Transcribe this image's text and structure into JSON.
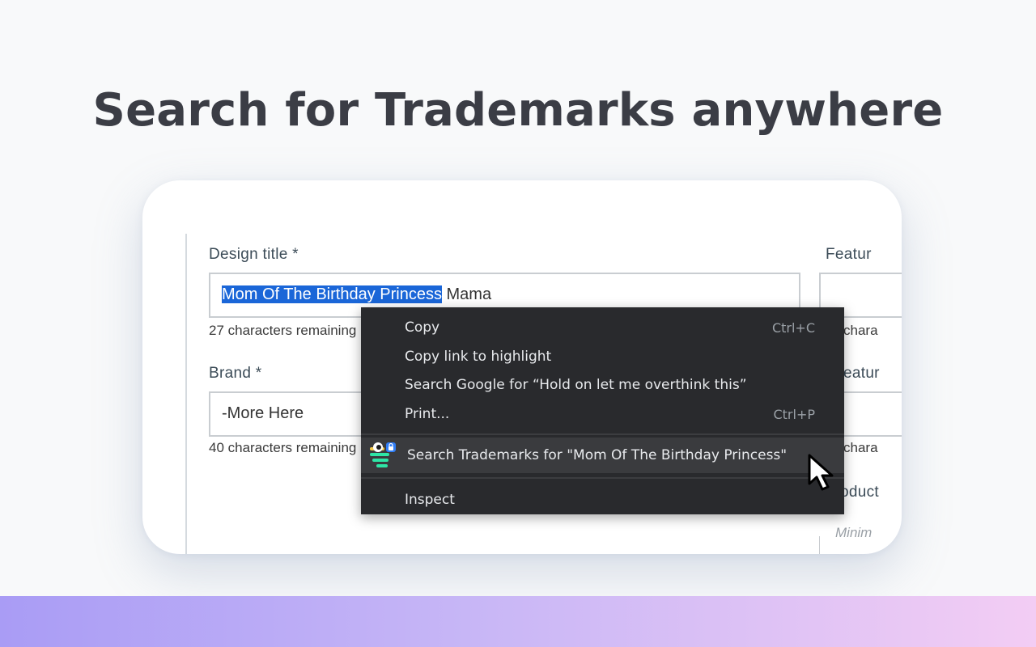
{
  "headline": "Search for Trademarks anywhere",
  "form": {
    "design_title_label": "Design title *",
    "design_title_selected": "Mom Of The Birthday Princess",
    "design_title_rest": " Mama",
    "design_title_helper": "27 characters remaining",
    "brand_label": "Brand *",
    "brand_value": "-More Here",
    "brand_helper": "40 characters remaining",
    "right_label_1": "Featur",
    "right_helper_1": "chara",
    "right_label_2": "eatur",
    "right_helper_2": "chara",
    "right_label_3": "oduct",
    "right_placeholder": "Minim"
  },
  "context_menu": {
    "items": [
      {
        "label": "Copy",
        "shortcut": "Ctrl+C"
      },
      {
        "label": "Copy link to highlight",
        "shortcut": ""
      },
      {
        "label": "Search Google for “Hold on let me overthink this”",
        "shortcut": ""
      },
      {
        "label": "Print...",
        "shortcut": "Ctrl+P"
      }
    ],
    "extension_item": {
      "label": "Search Trademarks for \"Mom Of The Birthday Princess\"",
      "icon": "trademark-extension-icon"
    },
    "inspect_label": "Inspect"
  },
  "colors": {
    "selection": "#1a66d8",
    "menu_bg": "#292a2d",
    "gradient_start": "#a99cf5",
    "gradient_end": "#f3cdf4"
  }
}
